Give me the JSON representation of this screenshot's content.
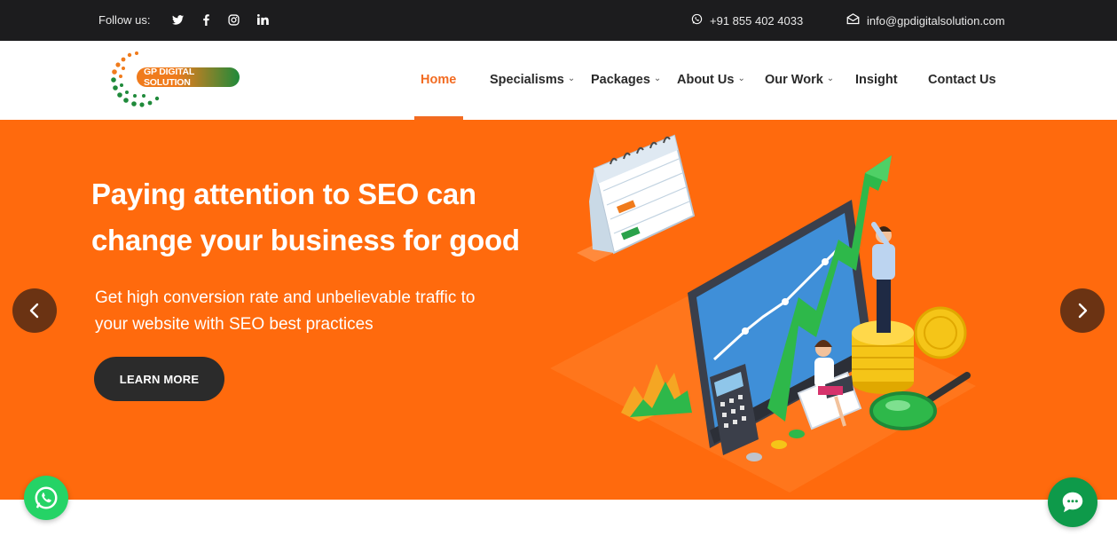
{
  "topbar": {
    "follow_label": "Follow us:",
    "social": [
      {
        "icon": "twitter-icon"
      },
      {
        "icon": "facebook-icon"
      },
      {
        "icon": "instagram-icon"
      },
      {
        "icon": "linkedin-icon"
      }
    ],
    "phone": "+91 855 402 4033",
    "email": "info@gpdigitalsolution.com"
  },
  "logo": {
    "text": "GP DIGITAL SOLUTION"
  },
  "nav": {
    "items": [
      {
        "label": "Home",
        "active": true
      },
      {
        "label": "Specialisms",
        "dropdown": true
      },
      {
        "label": "Packages",
        "dropdown": true
      },
      {
        "label": "About Us",
        "dropdown": true
      },
      {
        "label": "Our Work",
        "dropdown": true
      },
      {
        "label": "Insight"
      },
      {
        "label": "Contact Us"
      }
    ]
  },
  "hero": {
    "title_line1": "Paying attention to SEO can",
    "title_line2": "change your business for good",
    "subtitle_line1": "Get high conversion rate and unbelievable traffic to",
    "subtitle_line2": "your website with SEO best practices",
    "cta_label": "LEARN MORE"
  },
  "colors": {
    "accent": "#f26b21",
    "hero_bg": "#ff6a0d",
    "topbar_bg": "#1c1c1e",
    "whatsapp": "#25d366",
    "chat": "#0e9a4a"
  }
}
